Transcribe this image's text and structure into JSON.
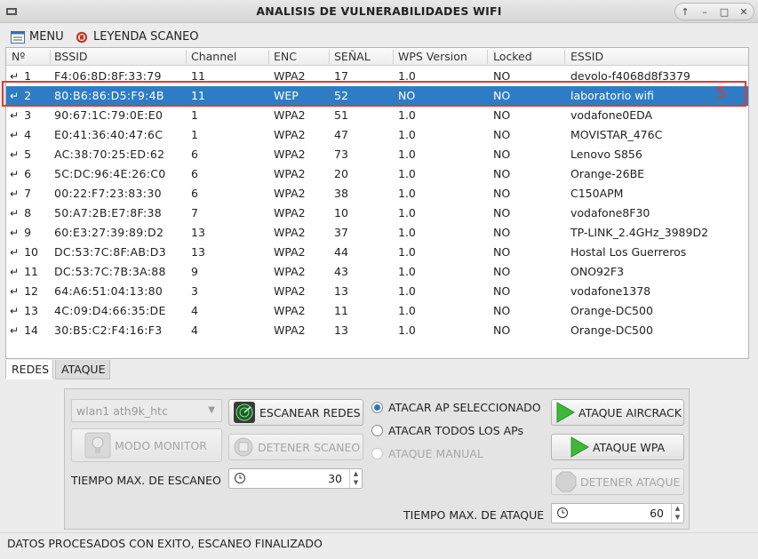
{
  "window": {
    "title": "ANALISIS DE VULNERABILIDADES WIFI",
    "controls": [
      "↑",
      "–",
      "□",
      "✕"
    ]
  },
  "menu": {
    "menu_label": "MENU",
    "legend_label": "LEYENDA SCANEO"
  },
  "table": {
    "headers": [
      "Nº",
      "BSSID",
      "Channel",
      "ENC",
      "SEÑAL",
      "WPS Version",
      "Locked",
      "ESSID"
    ],
    "rows": [
      {
        "n": "1",
        "bssid": "F4:06:8D:8F:33:79",
        "channel": "11",
        "enc": "WPA2",
        "signal": "17",
        "wps": "1.0",
        "locked": "NO",
        "essid": "devolo-f4068d8f3379"
      },
      {
        "n": "2",
        "bssid": "80:B6:86:D5:F9:4B",
        "channel": "11",
        "enc": "WEP",
        "signal": "52",
        "wps": "NO",
        "locked": "NO",
        "essid": "laboratorio wifi"
      },
      {
        "n": "3",
        "bssid": "90:67:1C:79:0E:E0",
        "channel": "1",
        "enc": "WPA2",
        "signal": "51",
        "wps": "1.0",
        "locked": "NO",
        "essid": "vodafone0EDA"
      },
      {
        "n": "4",
        "bssid": "E0:41:36:40:47:6C",
        "channel": "1",
        "enc": "WPA2",
        "signal": "47",
        "wps": "1.0",
        "locked": "NO",
        "essid": "MOVISTAR_476C"
      },
      {
        "n": "5",
        "bssid": "AC:38:70:25:ED:62",
        "channel": "6",
        "enc": "WPA2",
        "signal": "73",
        "wps": "1.0",
        "locked": "NO",
        "essid": "Lenovo S856"
      },
      {
        "n": "6",
        "bssid": "5C:DC:96:4E:26:C0",
        "channel": "6",
        "enc": "WPA2",
        "signal": "20",
        "wps": "1.0",
        "locked": "NO",
        "essid": "Orange-26BE"
      },
      {
        "n": "7",
        "bssid": "00:22:F7:23:83:30",
        "channel": "6",
        "enc": "WPA2",
        "signal": "38",
        "wps": "1.0",
        "locked": "NO",
        "essid": "C150APM"
      },
      {
        "n": "8",
        "bssid": "50:A7:2B:E7:8F:38",
        "channel": "7",
        "enc": "WPA2",
        "signal": "10",
        "wps": "1.0",
        "locked": "NO",
        "essid": "vodafone8F30"
      },
      {
        "n": "9",
        "bssid": "60:E3:27:39:89:D2",
        "channel": "13",
        "enc": "WPA2",
        "signal": "37",
        "wps": "1.0",
        "locked": "NO",
        "essid": "TP-LINK_2.4GHz_3989D2"
      },
      {
        "n": "10",
        "bssid": "DC:53:7C:8F:AB:D3",
        "channel": "13",
        "enc": "WPA2",
        "signal": "44",
        "wps": "1.0",
        "locked": "NO",
        "essid": "Hostal Los Guerreros"
      },
      {
        "n": "11",
        "bssid": "DC:53:7C:7B:3A:88",
        "channel": "9",
        "enc": "WPA2",
        "signal": "43",
        "wps": "1.0",
        "locked": "NO",
        "essid": "ONO92F3"
      },
      {
        "n": "12",
        "bssid": "64:A6:51:04:13:80",
        "channel": "3",
        "enc": "WPA2",
        "signal": "13",
        "wps": "1.0",
        "locked": "NO",
        "essid": "vodafone1378"
      },
      {
        "n": "13",
        "bssid": "4C:09:D4:66:35:DE",
        "channel": "4",
        "enc": "WPA2",
        "signal": "11",
        "wps": "1.0",
        "locked": "NO",
        "essid": "Orange-DC500"
      },
      {
        "n": "14",
        "bssid": "30:B5:C2:F4:16:F3",
        "channel": "4",
        "enc": "WPA2",
        "signal": "13",
        "wps": "1.0",
        "locked": "NO",
        "essid": "Orange-DC500"
      }
    ],
    "selected_row": 1,
    "annotation_number": "5"
  },
  "tabs": [
    "REDES",
    "ATAQUE"
  ],
  "controls": {
    "interface_value": "wlan1 ath9k_htc",
    "monitor_button": "MODO MONITOR",
    "scan_button": "ESCANEAR REDES",
    "stop_scan_button": "DETENER SCANEO",
    "scan_time_label": "TIEMPO MAX. DE ESCANEO",
    "scan_time_value": "30",
    "radio_selected": "ATACAR AP SELECCIONADO",
    "radio_all": "ATACAR TODOS LOS APs",
    "radio_manual": "ATAQUE MANUAL",
    "aircrack_button": "ATAQUE AIRCRACK",
    "wpa_button": "ATAQUE WPA",
    "stop_attack_button": "DETENER ATAQUE",
    "attack_time_label": "TIEMPO MAX. DE ATAQUE",
    "attack_time_value": "60"
  },
  "status": "DATOS PROCESADOS CON EXITO, ESCANEO FINALIZADO",
  "colors": {
    "selection": "#2e7cc4",
    "annotation": "#e23a2e",
    "play_green": "#3db83a"
  }
}
